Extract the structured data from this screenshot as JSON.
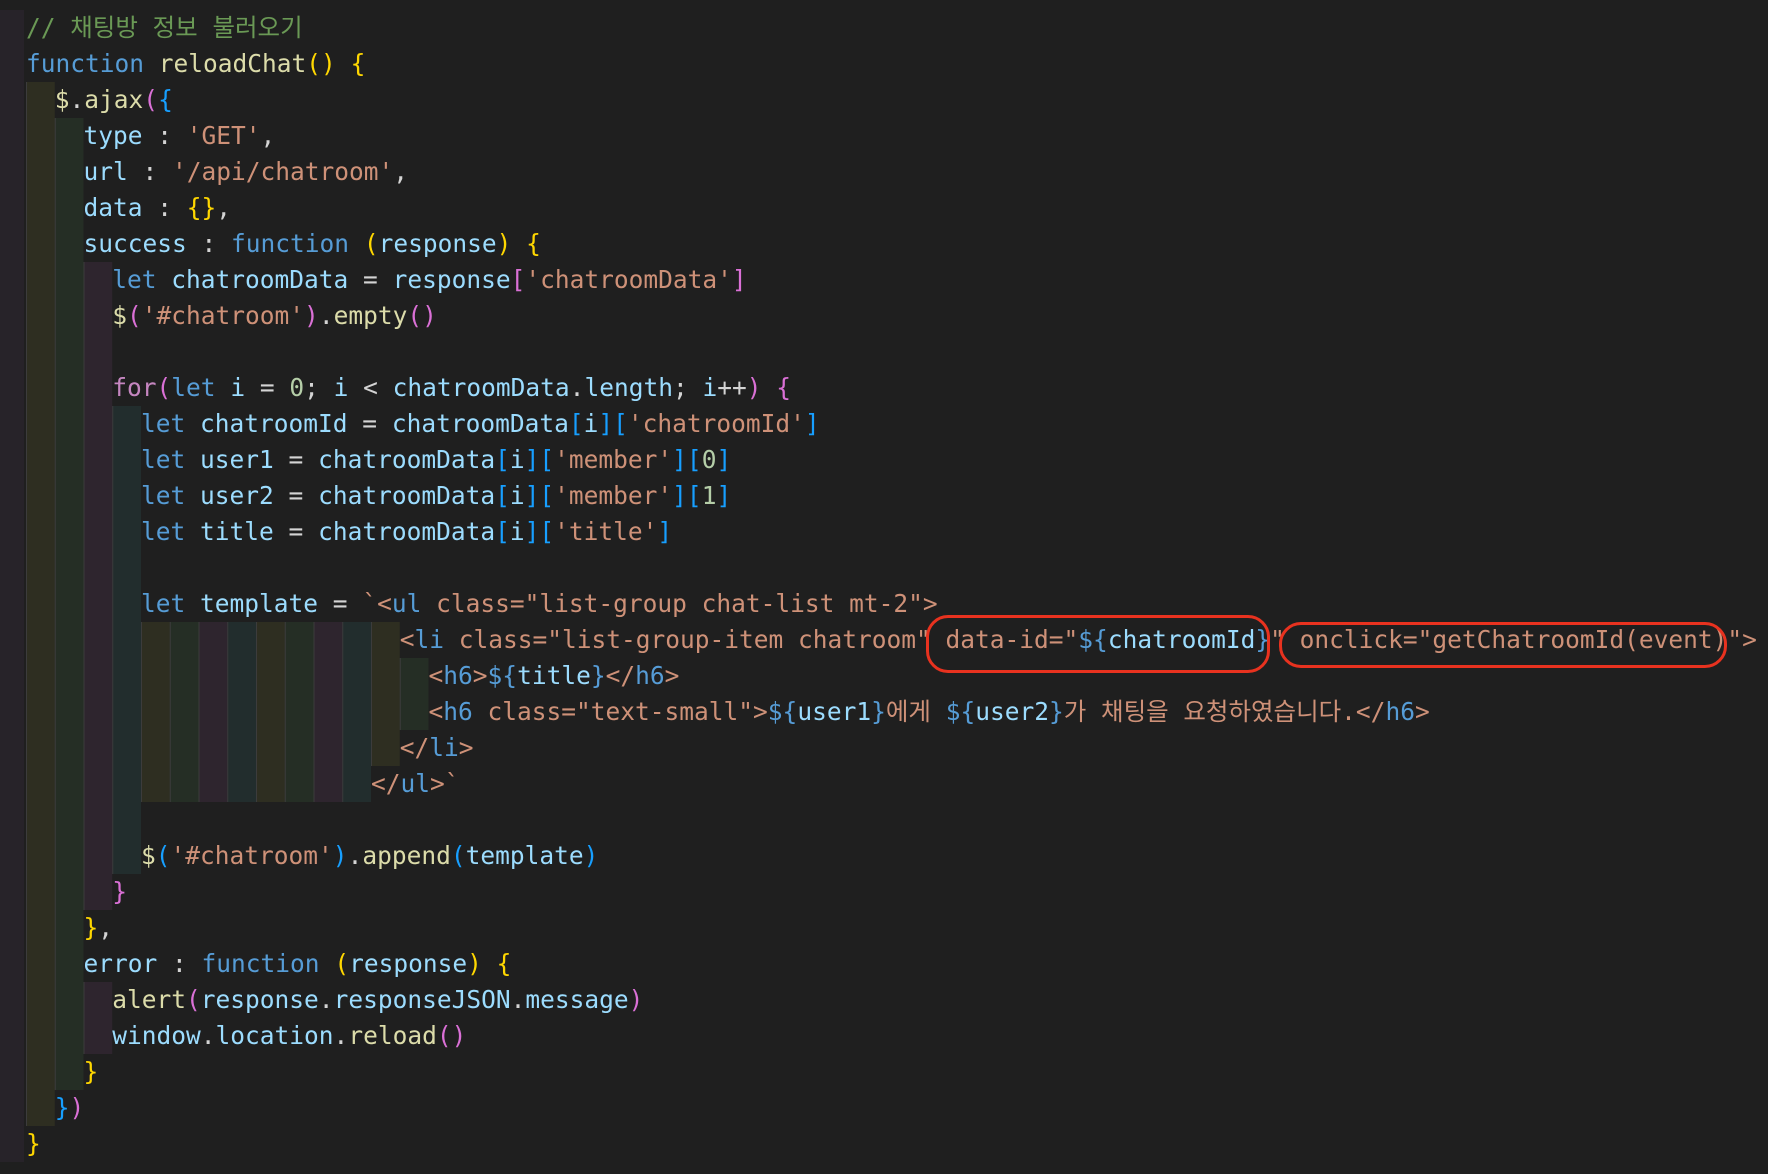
{
  "colors": {
    "background": "#1f1f1f",
    "comment": "#6a9955",
    "keyword": "#569cd6",
    "control": "#c586c0",
    "string": "#ce9178",
    "variable": "#9cdcfe",
    "function": "#dcdcaa",
    "number": "#b5cea8",
    "bracket1": "#ffd700",
    "bracket2": "#da70d6",
    "bracket3": "#179fff",
    "tag": "#569cd6",
    "punctuation": "#d4d4d4",
    "highlight": "#e8321f"
  },
  "editor": {
    "lines": [
      {
        "indent": 0,
        "tokens": [
          {
            "t": "// 채팅방 정보 불러오기",
            "c": "comment"
          }
        ]
      },
      {
        "indent": 0,
        "tokens": [
          {
            "t": "function",
            "c": "keyword"
          },
          {
            "t": " ",
            "c": "punctuation"
          },
          {
            "t": "reloadChat",
            "c": "function"
          },
          {
            "t": "()",
            "c": "bracket1"
          },
          {
            "t": " ",
            "c": "punctuation"
          },
          {
            "t": "{",
            "c": "bracket1"
          }
        ]
      },
      {
        "indent": 1,
        "tokens": [
          {
            "t": "$",
            "c": "function"
          },
          {
            "t": ".",
            "c": "punctuation"
          },
          {
            "t": "ajax",
            "c": "function"
          },
          {
            "t": "(",
            "c": "bracket2"
          },
          {
            "t": "{",
            "c": "bracket3"
          }
        ]
      },
      {
        "indent": 2,
        "tokens": [
          {
            "t": "type",
            "c": "variable"
          },
          {
            "t": " : ",
            "c": "punctuation"
          },
          {
            "t": "'GET'",
            "c": "string"
          },
          {
            "t": ",",
            "c": "punctuation"
          }
        ]
      },
      {
        "indent": 2,
        "tokens": [
          {
            "t": "url",
            "c": "variable"
          },
          {
            "t": " : ",
            "c": "punctuation"
          },
          {
            "t": "'/api/chatroom'",
            "c": "string"
          },
          {
            "t": ",",
            "c": "punctuation"
          }
        ]
      },
      {
        "indent": 2,
        "tokens": [
          {
            "t": "data",
            "c": "variable"
          },
          {
            "t": " : ",
            "c": "punctuation"
          },
          {
            "t": "{}",
            "c": "bracket1"
          },
          {
            "t": ",",
            "c": "punctuation"
          }
        ]
      },
      {
        "indent": 2,
        "tokens": [
          {
            "t": "success",
            "c": "variable"
          },
          {
            "t": " : ",
            "c": "punctuation"
          },
          {
            "t": "function",
            "c": "keyword"
          },
          {
            "t": " ",
            "c": "punctuation"
          },
          {
            "t": "(",
            "c": "bracket1"
          },
          {
            "t": "response",
            "c": "variable"
          },
          {
            "t": ")",
            "c": "bracket1"
          },
          {
            "t": " ",
            "c": "punctuation"
          },
          {
            "t": "{",
            "c": "bracket1"
          }
        ]
      },
      {
        "indent": 3,
        "tokens": [
          {
            "t": "let",
            "c": "keyword"
          },
          {
            "t": " ",
            "c": "punctuation"
          },
          {
            "t": "chatroomData",
            "c": "variable"
          },
          {
            "t": " = ",
            "c": "punctuation"
          },
          {
            "t": "response",
            "c": "variable"
          },
          {
            "t": "[",
            "c": "bracket2"
          },
          {
            "t": "'chatroomData'",
            "c": "string"
          },
          {
            "t": "]",
            "c": "bracket2"
          }
        ]
      },
      {
        "indent": 3,
        "tokens": [
          {
            "t": "$",
            "c": "function"
          },
          {
            "t": "(",
            "c": "bracket2"
          },
          {
            "t": "'#chatroom'",
            "c": "string"
          },
          {
            "t": ")",
            "c": "bracket2"
          },
          {
            "t": ".",
            "c": "punctuation"
          },
          {
            "t": "empty",
            "c": "function"
          },
          {
            "t": "()",
            "c": "bracket2"
          }
        ]
      },
      {
        "indent": 3,
        "tokens": []
      },
      {
        "indent": 3,
        "tokens": [
          {
            "t": "for",
            "c": "control"
          },
          {
            "t": "(",
            "c": "bracket2"
          },
          {
            "t": "let",
            "c": "keyword"
          },
          {
            "t": " ",
            "c": "punctuation"
          },
          {
            "t": "i",
            "c": "variable"
          },
          {
            "t": " = ",
            "c": "punctuation"
          },
          {
            "t": "0",
            "c": "number"
          },
          {
            "t": "; ",
            "c": "punctuation"
          },
          {
            "t": "i",
            "c": "variable"
          },
          {
            "t": " < ",
            "c": "punctuation"
          },
          {
            "t": "chatroomData",
            "c": "variable"
          },
          {
            "t": ".",
            "c": "punctuation"
          },
          {
            "t": "length",
            "c": "variable"
          },
          {
            "t": "; ",
            "c": "punctuation"
          },
          {
            "t": "i",
            "c": "variable"
          },
          {
            "t": "++",
            "c": "punctuation"
          },
          {
            "t": ")",
            "c": "bracket2"
          },
          {
            "t": " ",
            "c": "punctuation"
          },
          {
            "t": "{",
            "c": "bracket2"
          }
        ]
      },
      {
        "indent": 4,
        "tokens": [
          {
            "t": "let",
            "c": "keyword"
          },
          {
            "t": " ",
            "c": "punctuation"
          },
          {
            "t": "chatroomId",
            "c": "variable"
          },
          {
            "t": " = ",
            "c": "punctuation"
          },
          {
            "t": "chatroomData",
            "c": "variable"
          },
          {
            "t": "[",
            "c": "bracket3"
          },
          {
            "t": "i",
            "c": "variable"
          },
          {
            "t": "]",
            "c": "bracket3"
          },
          {
            "t": "[",
            "c": "bracket3"
          },
          {
            "t": "'chatroomId'",
            "c": "string"
          },
          {
            "t": "]",
            "c": "bracket3"
          }
        ]
      },
      {
        "indent": 4,
        "tokens": [
          {
            "t": "let",
            "c": "keyword"
          },
          {
            "t": " ",
            "c": "punctuation"
          },
          {
            "t": "user1",
            "c": "variable"
          },
          {
            "t": " = ",
            "c": "punctuation"
          },
          {
            "t": "chatroomData",
            "c": "variable"
          },
          {
            "t": "[",
            "c": "bracket3"
          },
          {
            "t": "i",
            "c": "variable"
          },
          {
            "t": "]",
            "c": "bracket3"
          },
          {
            "t": "[",
            "c": "bracket3"
          },
          {
            "t": "'member'",
            "c": "string"
          },
          {
            "t": "]",
            "c": "bracket3"
          },
          {
            "t": "[",
            "c": "bracket3"
          },
          {
            "t": "0",
            "c": "number"
          },
          {
            "t": "]",
            "c": "bracket3"
          }
        ]
      },
      {
        "indent": 4,
        "tokens": [
          {
            "t": "let",
            "c": "keyword"
          },
          {
            "t": " ",
            "c": "punctuation"
          },
          {
            "t": "user2",
            "c": "variable"
          },
          {
            "t": " = ",
            "c": "punctuation"
          },
          {
            "t": "chatroomData",
            "c": "variable"
          },
          {
            "t": "[",
            "c": "bracket3"
          },
          {
            "t": "i",
            "c": "variable"
          },
          {
            "t": "]",
            "c": "bracket3"
          },
          {
            "t": "[",
            "c": "bracket3"
          },
          {
            "t": "'member'",
            "c": "string"
          },
          {
            "t": "]",
            "c": "bracket3"
          },
          {
            "t": "[",
            "c": "bracket3"
          },
          {
            "t": "1",
            "c": "number"
          },
          {
            "t": "]",
            "c": "bracket3"
          }
        ]
      },
      {
        "indent": 4,
        "tokens": [
          {
            "t": "let",
            "c": "keyword"
          },
          {
            "t": " ",
            "c": "punctuation"
          },
          {
            "t": "title",
            "c": "variable"
          },
          {
            "t": " = ",
            "c": "punctuation"
          },
          {
            "t": "chatroomData",
            "c": "variable"
          },
          {
            "t": "[",
            "c": "bracket3"
          },
          {
            "t": "i",
            "c": "variable"
          },
          {
            "t": "]",
            "c": "bracket3"
          },
          {
            "t": "[",
            "c": "bracket3"
          },
          {
            "t": "'title'",
            "c": "string"
          },
          {
            "t": "]",
            "c": "bracket3"
          }
        ]
      },
      {
        "indent": 4,
        "tokens": []
      },
      {
        "indent": 4,
        "tokens": [
          {
            "t": "let",
            "c": "keyword"
          },
          {
            "t": " ",
            "c": "punctuation"
          },
          {
            "t": "template",
            "c": "variable"
          },
          {
            "t": " = ",
            "c": "punctuation"
          },
          {
            "t": "`<",
            "c": "string"
          },
          {
            "t": "ul",
            "c": "tag"
          },
          {
            "t": " class=\"list-group chat-list mt-2\">",
            "c": "string"
          }
        ]
      },
      {
        "indent": 13,
        "tokens": [
          {
            "t": "<",
            "c": "string"
          },
          {
            "t": "li",
            "c": "tag"
          },
          {
            "t": " class=\"list-group-item chatroom\" data-id=\"",
            "c": "string"
          },
          {
            "t": "${",
            "c": "keyword"
          },
          {
            "t": "chatroomId",
            "c": "variable"
          },
          {
            "t": "}",
            "c": "keyword"
          },
          {
            "t": "\" onclick=\"getChatroomId(event)\">",
            "c": "string"
          }
        ]
      },
      {
        "indent": 14,
        "tokens": [
          {
            "t": "<",
            "c": "string"
          },
          {
            "t": "h6",
            "c": "tag"
          },
          {
            "t": ">",
            "c": "string"
          },
          {
            "t": "${",
            "c": "keyword"
          },
          {
            "t": "title",
            "c": "variable"
          },
          {
            "t": "}",
            "c": "keyword"
          },
          {
            "t": "</",
            "c": "string"
          },
          {
            "t": "h6",
            "c": "tag"
          },
          {
            "t": ">",
            "c": "string"
          }
        ]
      },
      {
        "indent": 14,
        "tokens": [
          {
            "t": "<",
            "c": "string"
          },
          {
            "t": "h6",
            "c": "tag"
          },
          {
            "t": " class=\"text-small\">",
            "c": "string"
          },
          {
            "t": "${",
            "c": "keyword"
          },
          {
            "t": "user1",
            "c": "variable"
          },
          {
            "t": "}",
            "c": "keyword"
          },
          {
            "t": "에게 ",
            "c": "string"
          },
          {
            "t": "${",
            "c": "keyword"
          },
          {
            "t": "user2",
            "c": "variable"
          },
          {
            "t": "}",
            "c": "keyword"
          },
          {
            "t": "가 채팅을 요청하였습니다.</",
            "c": "string"
          },
          {
            "t": "h6",
            "c": "tag"
          },
          {
            "t": ">",
            "c": "string"
          }
        ]
      },
      {
        "indent": 13,
        "tokens": [
          {
            "t": "</",
            "c": "string"
          },
          {
            "t": "li",
            "c": "tag"
          },
          {
            "t": ">",
            "c": "string"
          }
        ]
      },
      {
        "indent": 12,
        "tokens": [
          {
            "t": "</",
            "c": "string"
          },
          {
            "t": "ul",
            "c": "tag"
          },
          {
            "t": ">`",
            "c": "string"
          }
        ]
      },
      {
        "indent": 4,
        "tokens": []
      },
      {
        "indent": 4,
        "tokens": [
          {
            "t": "$",
            "c": "function"
          },
          {
            "t": "(",
            "c": "bracket3"
          },
          {
            "t": "'#chatroom'",
            "c": "string"
          },
          {
            "t": ")",
            "c": "bracket3"
          },
          {
            "t": ".",
            "c": "punctuation"
          },
          {
            "t": "append",
            "c": "function"
          },
          {
            "t": "(",
            "c": "bracket3"
          },
          {
            "t": "template",
            "c": "variable"
          },
          {
            "t": ")",
            "c": "bracket3"
          }
        ]
      },
      {
        "indent": 3,
        "tokens": [
          {
            "t": "}",
            "c": "bracket2"
          }
        ]
      },
      {
        "indent": 2,
        "tokens": [
          {
            "t": "}",
            "c": "bracket1"
          },
          {
            "t": ",",
            "c": "punctuation"
          }
        ]
      },
      {
        "indent": 2,
        "tokens": [
          {
            "t": "error",
            "c": "variable"
          },
          {
            "t": " : ",
            "c": "punctuation"
          },
          {
            "t": "function",
            "c": "keyword"
          },
          {
            "t": " ",
            "c": "punctuation"
          },
          {
            "t": "(",
            "c": "bracket1"
          },
          {
            "t": "response",
            "c": "variable"
          },
          {
            "t": ")",
            "c": "bracket1"
          },
          {
            "t": " ",
            "c": "punctuation"
          },
          {
            "t": "{",
            "c": "bracket1"
          }
        ]
      },
      {
        "indent": 3,
        "tokens": [
          {
            "t": "alert",
            "c": "function"
          },
          {
            "t": "(",
            "c": "bracket2"
          },
          {
            "t": "response",
            "c": "variable"
          },
          {
            "t": ".",
            "c": "punctuation"
          },
          {
            "t": "responseJSON",
            "c": "variable"
          },
          {
            "t": ".",
            "c": "punctuation"
          },
          {
            "t": "message",
            "c": "variable"
          },
          {
            "t": ")",
            "c": "bracket2"
          }
        ]
      },
      {
        "indent": 3,
        "tokens": [
          {
            "t": "window",
            "c": "variable"
          },
          {
            "t": ".",
            "c": "punctuation"
          },
          {
            "t": "location",
            "c": "variable"
          },
          {
            "t": ".",
            "c": "punctuation"
          },
          {
            "t": "reload",
            "c": "function"
          },
          {
            "t": "()",
            "c": "bracket2"
          }
        ]
      },
      {
        "indent": 2,
        "tokens": [
          {
            "t": "}",
            "c": "bracket1"
          }
        ]
      },
      {
        "indent": 1,
        "tokens": [
          {
            "t": "}",
            "c": "bracket3"
          },
          {
            "t": ")",
            "c": "bracket2"
          }
        ]
      },
      {
        "indent": 0,
        "tokens": [
          {
            "t": "}",
            "c": "bracket1"
          }
        ]
      }
    ]
  }
}
